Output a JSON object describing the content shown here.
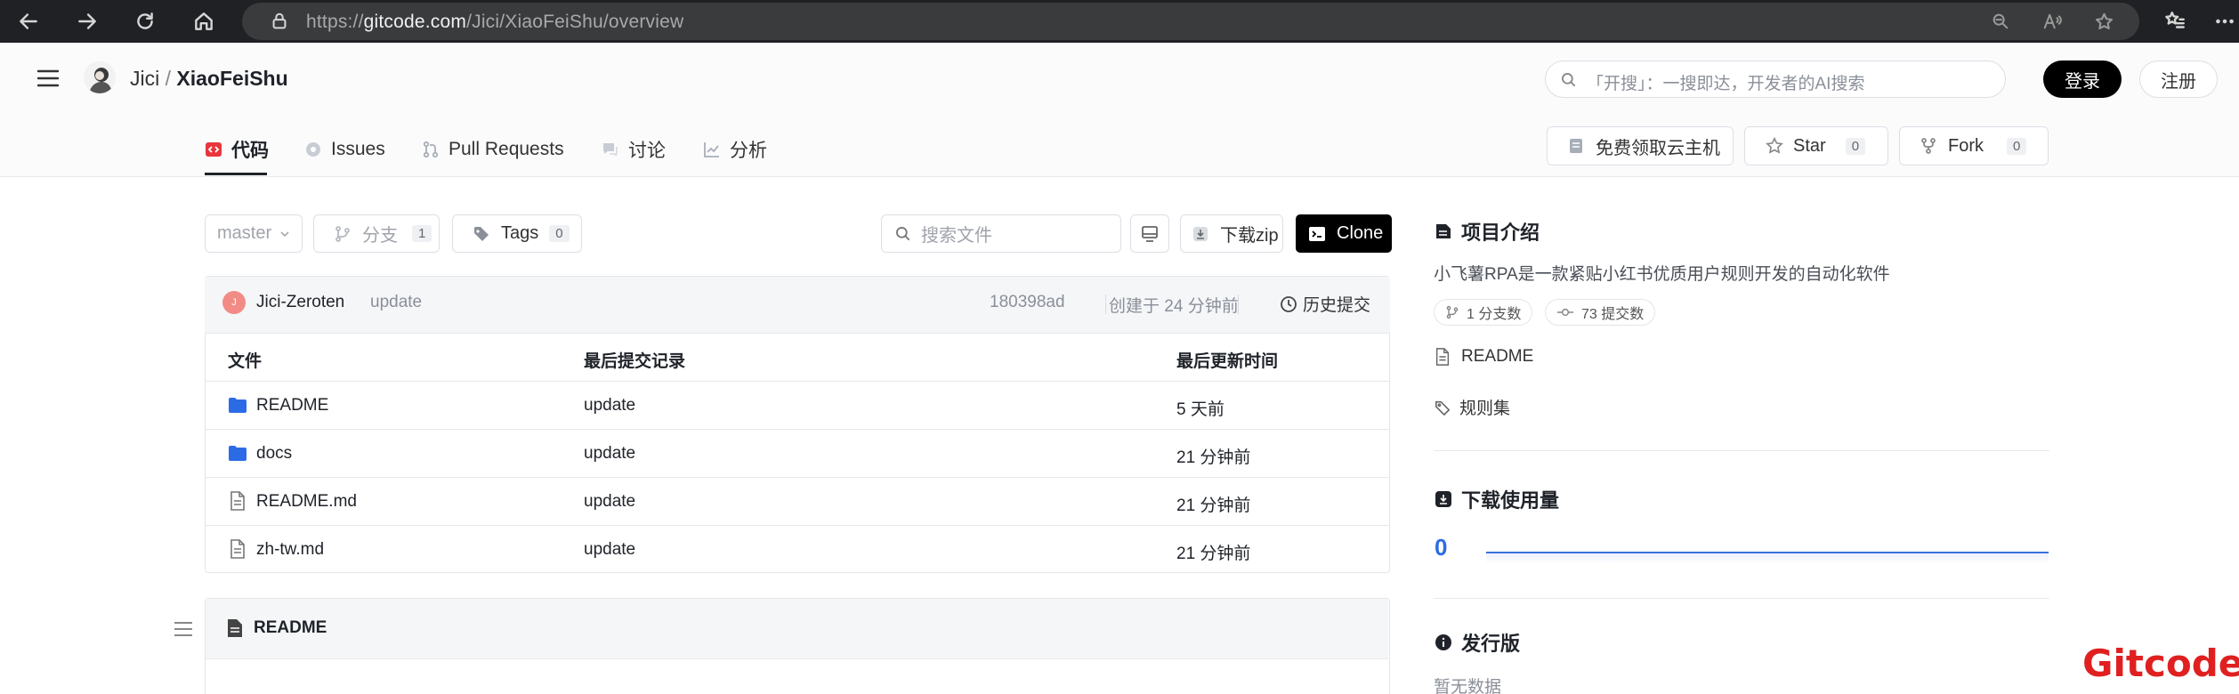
{
  "browser": {
    "url_prefix": "https://",
    "url_host": "gitcode.com",
    "url_path": "/Jici/XiaoFeiShu/overview"
  },
  "header": {
    "owner": "Jici",
    "separator": "/",
    "repo": "XiaoFeiShu",
    "search_placeholder": "「开搜」：一搜即达，开发者的AI搜索",
    "login_label": "登录",
    "register_label": "注册"
  },
  "tabs": [
    {
      "label": "代码"
    },
    {
      "label": "Issues"
    },
    {
      "label": "Pull Requests"
    },
    {
      "label": "讨论"
    },
    {
      "label": "分析"
    }
  ],
  "repo_actions": {
    "cloud_label": "免费领取云主机",
    "star_label": "Star",
    "star_count": "0",
    "fork_label": "Fork",
    "fork_count": "0"
  },
  "toolbar": {
    "branch": "master",
    "branches_label": "分支",
    "branches_count": "1",
    "tags_label": "Tags",
    "tags_count": "0",
    "file_search_placeholder": "搜索文件",
    "download_label": "下载zip",
    "clone_label": "Clone"
  },
  "commit": {
    "avatar_letter": "J",
    "author": "Jici-Zeroten",
    "message": "update",
    "hash": "180398ad",
    "time": "创建于 24 分钟前",
    "history_label": "历史提交"
  },
  "file_table": {
    "headers": [
      "文件",
      "最后提交记录",
      "最后更新时间"
    ],
    "rows": [
      {
        "name": "README",
        "type": "folder",
        "message": "update",
        "time": "5 天前"
      },
      {
        "name": "docs",
        "type": "folder",
        "message": "update",
        "time": "21 分钟前"
      },
      {
        "name": "README.md",
        "type": "file",
        "message": "update",
        "time": "21 分钟前"
      },
      {
        "name": "zh-tw.md",
        "type": "file",
        "message": "update",
        "time": "21 分钟前"
      }
    ]
  },
  "readme": {
    "title": "README"
  },
  "sidebar": {
    "intro_title": "项目介绍",
    "description": "小飞薯RPA是一款紧贴小红书优质用户规则开发的自动化软件",
    "branch_count_label": "1 分支数",
    "commit_count_label": "73 提交数",
    "readme_link": "README",
    "rules_link": "规则集",
    "downloads_title": "下载使用量",
    "downloads_count": "0",
    "releases_title": "发行版",
    "releases_empty": "暂无数据"
  },
  "watermark": "Gitcode",
  "colors": {
    "accent": "#e8363c",
    "brand_dark": "#000000",
    "folder_blue": "#2c6be6",
    "chart_blue": "#3b6fe0"
  }
}
